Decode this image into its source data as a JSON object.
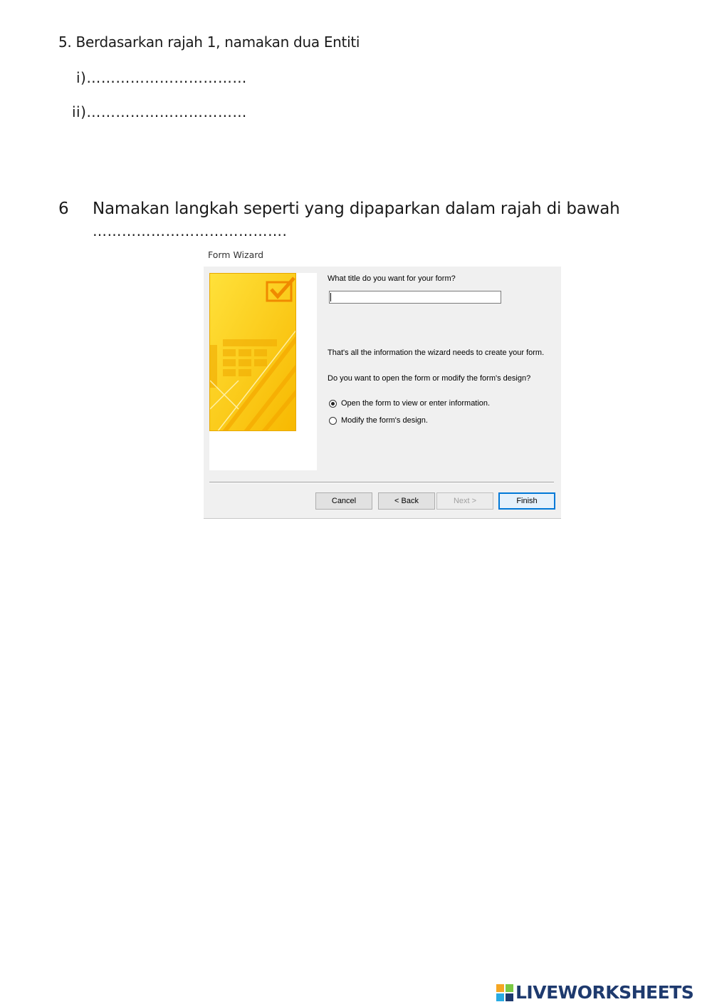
{
  "question5": {
    "text": "5. Berdasarkan rajah 1, namakan dua Entiti",
    "answer_i": "i)……………………………",
    "answer_ii": "ii)……………………………"
  },
  "question6": {
    "number": "6",
    "text": "Namakan langkah seperti yang dipaparkan dalam rajah di bawah",
    "answer_line": "…………………………………."
  },
  "wizard": {
    "window_title": "Form Wizard",
    "title_question": "What title do you want for your form?",
    "title_value": "",
    "info_text": "That's all the information the wizard needs to create your form.",
    "ask_text": "Do you want to open the form or modify the form's design?",
    "options": [
      {
        "label": "Open the form to view or enter information.",
        "selected": true
      },
      {
        "label": "Modify the form's design.",
        "selected": false
      }
    ],
    "buttons": {
      "cancel": "Cancel",
      "back": "< Back",
      "next": "Next >",
      "finish": "Finish"
    }
  },
  "footer": {
    "logo_text": "LIVEWORKSHEETS"
  },
  "colors": {
    "art_yellow": "#ffd21f",
    "art_orange": "#f5b400",
    "focus_blue": "#0078d7",
    "logo_navy": "#1e3a6e"
  }
}
